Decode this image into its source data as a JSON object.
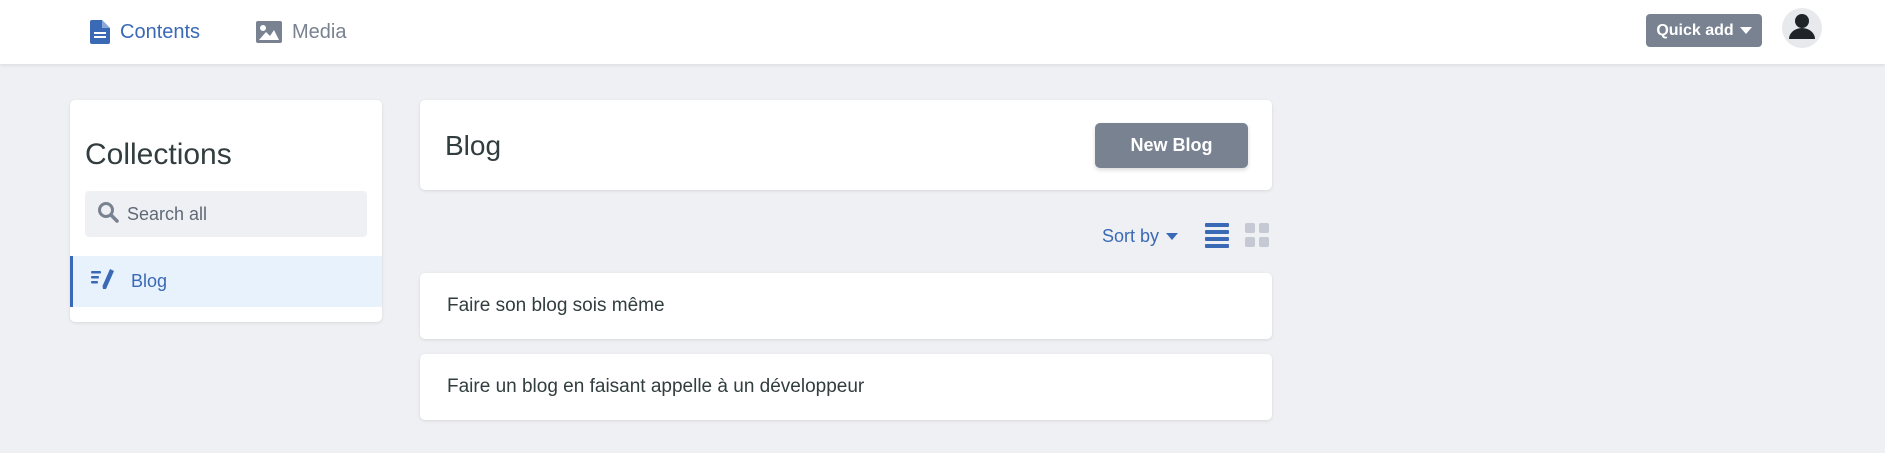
{
  "nav": {
    "tabs": [
      {
        "label": "Contents",
        "icon": "document-icon",
        "active": true
      },
      {
        "label": "Media",
        "icon": "image-icon",
        "active": false
      }
    ],
    "quick_add_label": "Quick add",
    "avatar_icon": "user-icon"
  },
  "sidebar": {
    "title": "Collections",
    "search_placeholder": "Search all",
    "items": [
      {
        "label": "Blog",
        "icon": "write-icon",
        "active": true
      }
    ]
  },
  "main": {
    "collection_title": "Blog",
    "new_button_label": "New Blog",
    "sort_label": "Sort by",
    "view_modes": [
      "list",
      "grid"
    ],
    "active_view": "list",
    "entries": [
      {
        "title": "Faire son blog sois même"
      },
      {
        "title": "Faire un blog en faisant appelle à un développeur"
      }
    ]
  },
  "colors": {
    "accent": "#3a69b5",
    "muted": "#798291",
    "background": "#eff0f4",
    "active_item_bg": "#e8f2fd"
  }
}
